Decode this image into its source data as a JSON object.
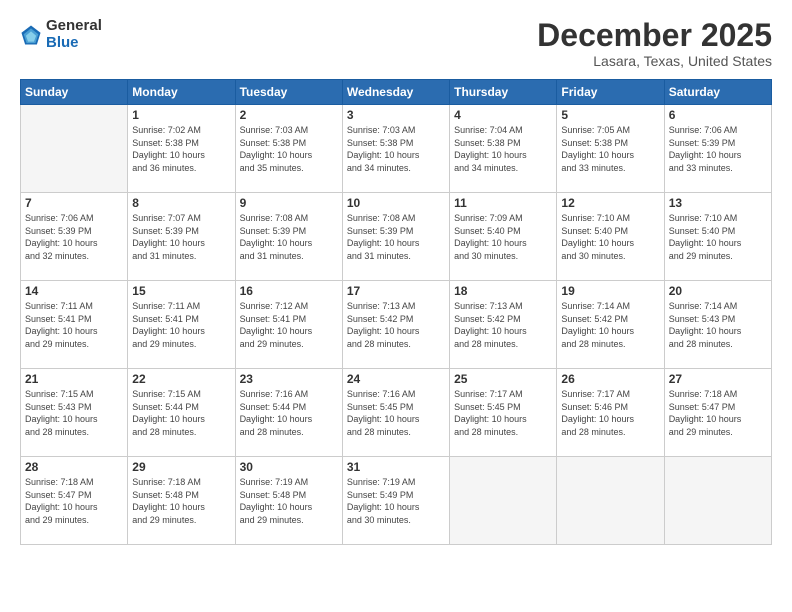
{
  "header": {
    "logo_general": "General",
    "logo_blue": "Blue",
    "month_title": "December 2025",
    "location": "Lasara, Texas, United States"
  },
  "calendar": {
    "days_of_week": [
      "Sunday",
      "Monday",
      "Tuesday",
      "Wednesday",
      "Thursday",
      "Friday",
      "Saturday"
    ],
    "weeks": [
      [
        {
          "day": "",
          "info": ""
        },
        {
          "day": "1",
          "info": "Sunrise: 7:02 AM\nSunset: 5:38 PM\nDaylight: 10 hours\nand 36 minutes."
        },
        {
          "day": "2",
          "info": "Sunrise: 7:03 AM\nSunset: 5:38 PM\nDaylight: 10 hours\nand 35 minutes."
        },
        {
          "day": "3",
          "info": "Sunrise: 7:03 AM\nSunset: 5:38 PM\nDaylight: 10 hours\nand 34 minutes."
        },
        {
          "day": "4",
          "info": "Sunrise: 7:04 AM\nSunset: 5:38 PM\nDaylight: 10 hours\nand 34 minutes."
        },
        {
          "day": "5",
          "info": "Sunrise: 7:05 AM\nSunset: 5:38 PM\nDaylight: 10 hours\nand 33 minutes."
        },
        {
          "day": "6",
          "info": "Sunrise: 7:06 AM\nSunset: 5:39 PM\nDaylight: 10 hours\nand 33 minutes."
        }
      ],
      [
        {
          "day": "7",
          "info": "Sunrise: 7:06 AM\nSunset: 5:39 PM\nDaylight: 10 hours\nand 32 minutes."
        },
        {
          "day": "8",
          "info": "Sunrise: 7:07 AM\nSunset: 5:39 PM\nDaylight: 10 hours\nand 31 minutes."
        },
        {
          "day": "9",
          "info": "Sunrise: 7:08 AM\nSunset: 5:39 PM\nDaylight: 10 hours\nand 31 minutes."
        },
        {
          "day": "10",
          "info": "Sunrise: 7:08 AM\nSunset: 5:39 PM\nDaylight: 10 hours\nand 31 minutes."
        },
        {
          "day": "11",
          "info": "Sunrise: 7:09 AM\nSunset: 5:40 PM\nDaylight: 10 hours\nand 30 minutes."
        },
        {
          "day": "12",
          "info": "Sunrise: 7:10 AM\nSunset: 5:40 PM\nDaylight: 10 hours\nand 30 minutes."
        },
        {
          "day": "13",
          "info": "Sunrise: 7:10 AM\nSunset: 5:40 PM\nDaylight: 10 hours\nand 29 minutes."
        }
      ],
      [
        {
          "day": "14",
          "info": "Sunrise: 7:11 AM\nSunset: 5:41 PM\nDaylight: 10 hours\nand 29 minutes."
        },
        {
          "day": "15",
          "info": "Sunrise: 7:11 AM\nSunset: 5:41 PM\nDaylight: 10 hours\nand 29 minutes."
        },
        {
          "day": "16",
          "info": "Sunrise: 7:12 AM\nSunset: 5:41 PM\nDaylight: 10 hours\nand 29 minutes."
        },
        {
          "day": "17",
          "info": "Sunrise: 7:13 AM\nSunset: 5:42 PM\nDaylight: 10 hours\nand 28 minutes."
        },
        {
          "day": "18",
          "info": "Sunrise: 7:13 AM\nSunset: 5:42 PM\nDaylight: 10 hours\nand 28 minutes."
        },
        {
          "day": "19",
          "info": "Sunrise: 7:14 AM\nSunset: 5:42 PM\nDaylight: 10 hours\nand 28 minutes."
        },
        {
          "day": "20",
          "info": "Sunrise: 7:14 AM\nSunset: 5:43 PM\nDaylight: 10 hours\nand 28 minutes."
        }
      ],
      [
        {
          "day": "21",
          "info": "Sunrise: 7:15 AM\nSunset: 5:43 PM\nDaylight: 10 hours\nand 28 minutes."
        },
        {
          "day": "22",
          "info": "Sunrise: 7:15 AM\nSunset: 5:44 PM\nDaylight: 10 hours\nand 28 minutes."
        },
        {
          "day": "23",
          "info": "Sunrise: 7:16 AM\nSunset: 5:44 PM\nDaylight: 10 hours\nand 28 minutes."
        },
        {
          "day": "24",
          "info": "Sunrise: 7:16 AM\nSunset: 5:45 PM\nDaylight: 10 hours\nand 28 minutes."
        },
        {
          "day": "25",
          "info": "Sunrise: 7:17 AM\nSunset: 5:45 PM\nDaylight: 10 hours\nand 28 minutes."
        },
        {
          "day": "26",
          "info": "Sunrise: 7:17 AM\nSunset: 5:46 PM\nDaylight: 10 hours\nand 28 minutes."
        },
        {
          "day": "27",
          "info": "Sunrise: 7:18 AM\nSunset: 5:47 PM\nDaylight: 10 hours\nand 29 minutes."
        }
      ],
      [
        {
          "day": "28",
          "info": "Sunrise: 7:18 AM\nSunset: 5:47 PM\nDaylight: 10 hours\nand 29 minutes."
        },
        {
          "day": "29",
          "info": "Sunrise: 7:18 AM\nSunset: 5:48 PM\nDaylight: 10 hours\nand 29 minutes."
        },
        {
          "day": "30",
          "info": "Sunrise: 7:19 AM\nSunset: 5:48 PM\nDaylight: 10 hours\nand 29 minutes."
        },
        {
          "day": "31",
          "info": "Sunrise: 7:19 AM\nSunset: 5:49 PM\nDaylight: 10 hours\nand 30 minutes."
        },
        {
          "day": "",
          "info": ""
        },
        {
          "day": "",
          "info": ""
        },
        {
          "day": "",
          "info": ""
        }
      ]
    ]
  }
}
